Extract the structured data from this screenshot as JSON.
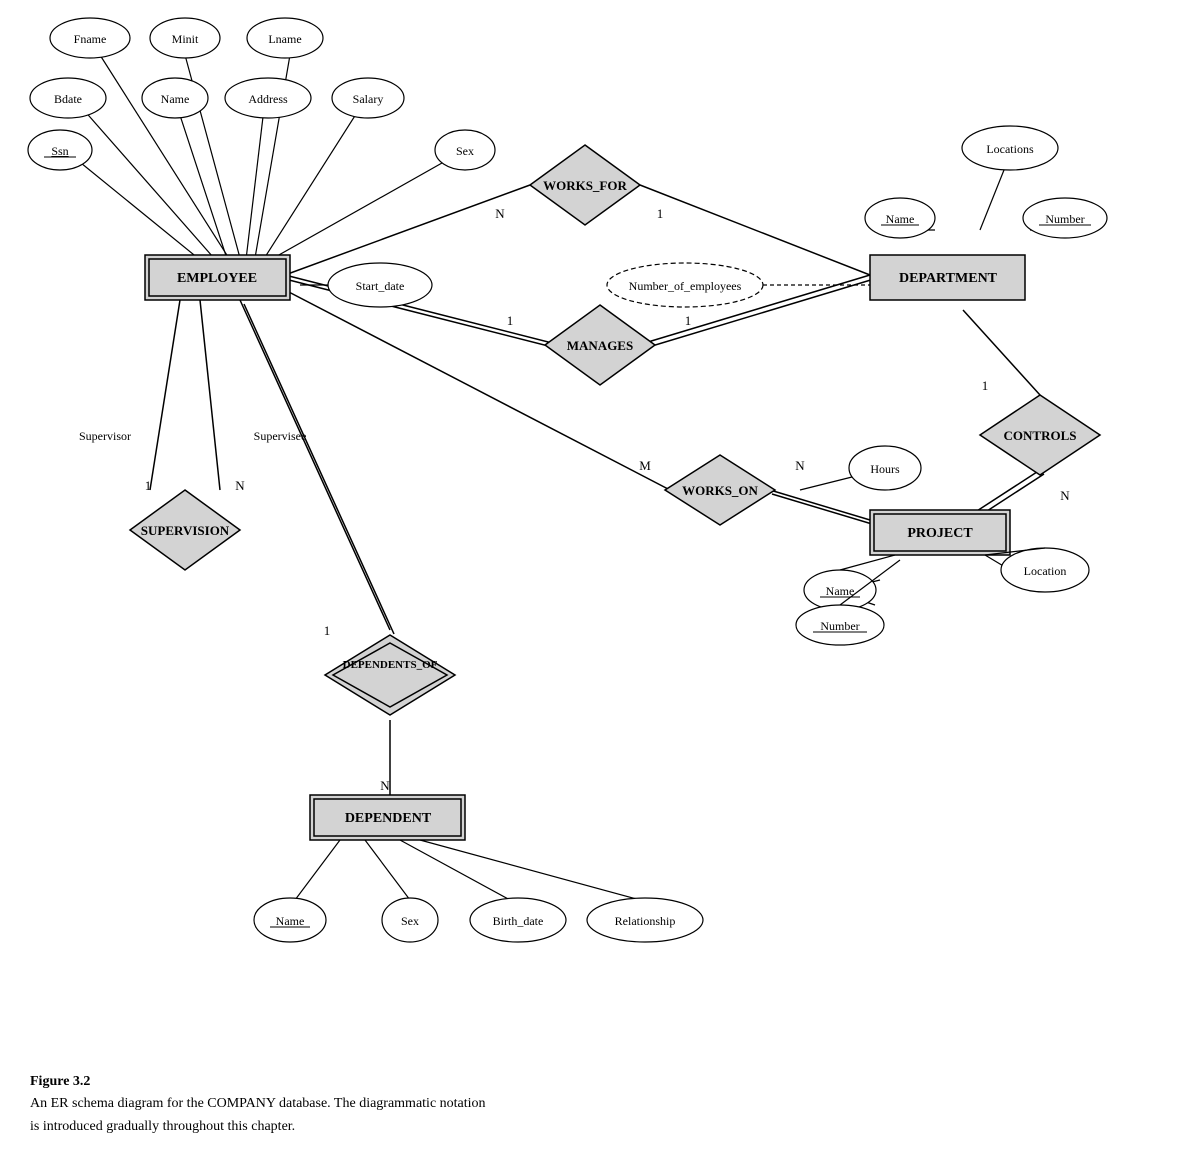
{
  "title": "Figure 3.2 ER Schema Diagram",
  "caption": {
    "figure_label": "Figure 3.2",
    "description_line1": "An ER schema diagram for the COMPANY database. The diagrammatic notation",
    "description_line2": "is introduced gradually throughout this chapter."
  },
  "entities": {
    "employee": "EMPLOYEE",
    "department": "DEPARTMENT",
    "project": "PROJECT",
    "dependent": "DEPENDENT"
  },
  "relationships": {
    "works_for": "WORKS_FOR",
    "manages": "MANAGES",
    "works_on": "WORKS_ON",
    "controls": "CONTROLS",
    "supervision": "SUPERVISION",
    "dependents_of": "DEPENDENTS_OF"
  },
  "attributes": {
    "fname": "Fname",
    "minit": "Minit",
    "lname": "Lname",
    "bdate": "Bdate",
    "name_emp": "Name",
    "address": "Address",
    "salary": "Salary",
    "ssn": "Ssn",
    "sex_emp": "Sex",
    "start_date": "Start_date",
    "number_of_employees": "Number_of_employees",
    "locations": "Locations",
    "dept_name": "Name",
    "dept_number": "Number",
    "hours": "Hours",
    "proj_name": "Name",
    "proj_number": "Number",
    "location": "Location",
    "dep_name": "Name",
    "dep_sex": "Sex",
    "birth_date": "Birth_date",
    "relationship": "Relationship"
  }
}
